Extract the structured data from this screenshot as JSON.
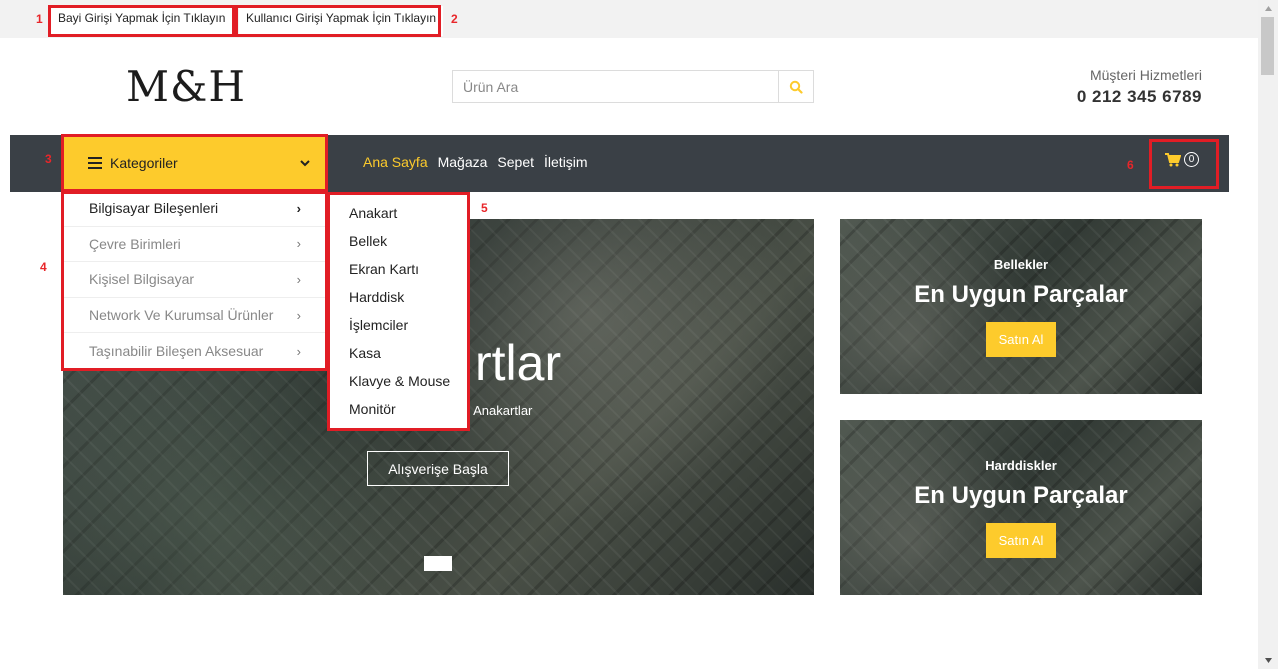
{
  "annotations": [
    "1",
    "2",
    "3",
    "4",
    "5",
    "6"
  ],
  "topbar": {
    "dealer_login": "Bayi Girişi Yapmak İçin Tıklayın",
    "user_login": "Kullanıcı Girişi Yapmak İçin Tıklayın"
  },
  "header": {
    "logo": "M&H",
    "search_placeholder": "Ürün Ara",
    "support_label": "Müşteri Hizmetleri",
    "support_phone": "0 212 345 6789"
  },
  "nav": {
    "categories_label": "Kategoriler",
    "links": [
      "Ana Sayfa",
      "Mağaza",
      "Sepet",
      "İletişim"
    ],
    "active_link": "Ana Sayfa",
    "cart_count": "0"
  },
  "category_menu": {
    "items": [
      "Bilgisayar Bileşenleri",
      "Çevre Birimleri",
      "Kişisel Bilgisayar",
      "Network Ve Kurumsal Ürünler",
      "Taşınabilir Bileşen Aksesuar"
    ],
    "active_item": "Bilgisayar Bileşenleri",
    "subitems": [
      "Anakart",
      "Bellek",
      "Ekran Kartı",
      "Harddisk",
      "İşlemciler",
      "Kasa",
      "Klavye & Mouse",
      "Monitör"
    ]
  },
  "hero": {
    "title_visible": "rtlar",
    "subtitle_visible": "n Anakartlar",
    "button": "Alışverişe Başla"
  },
  "promos": [
    {
      "category": "Bellekler",
      "title": "En Uygun Parçalar",
      "button": "Satın Al"
    },
    {
      "category": "Harddiskler",
      "title": "En Uygun Parçalar",
      "button": "Satın Al"
    }
  ],
  "colors": {
    "accent": "#fdcb2c",
    "navbar": "#3a4046",
    "annotation": "#e11d25"
  }
}
